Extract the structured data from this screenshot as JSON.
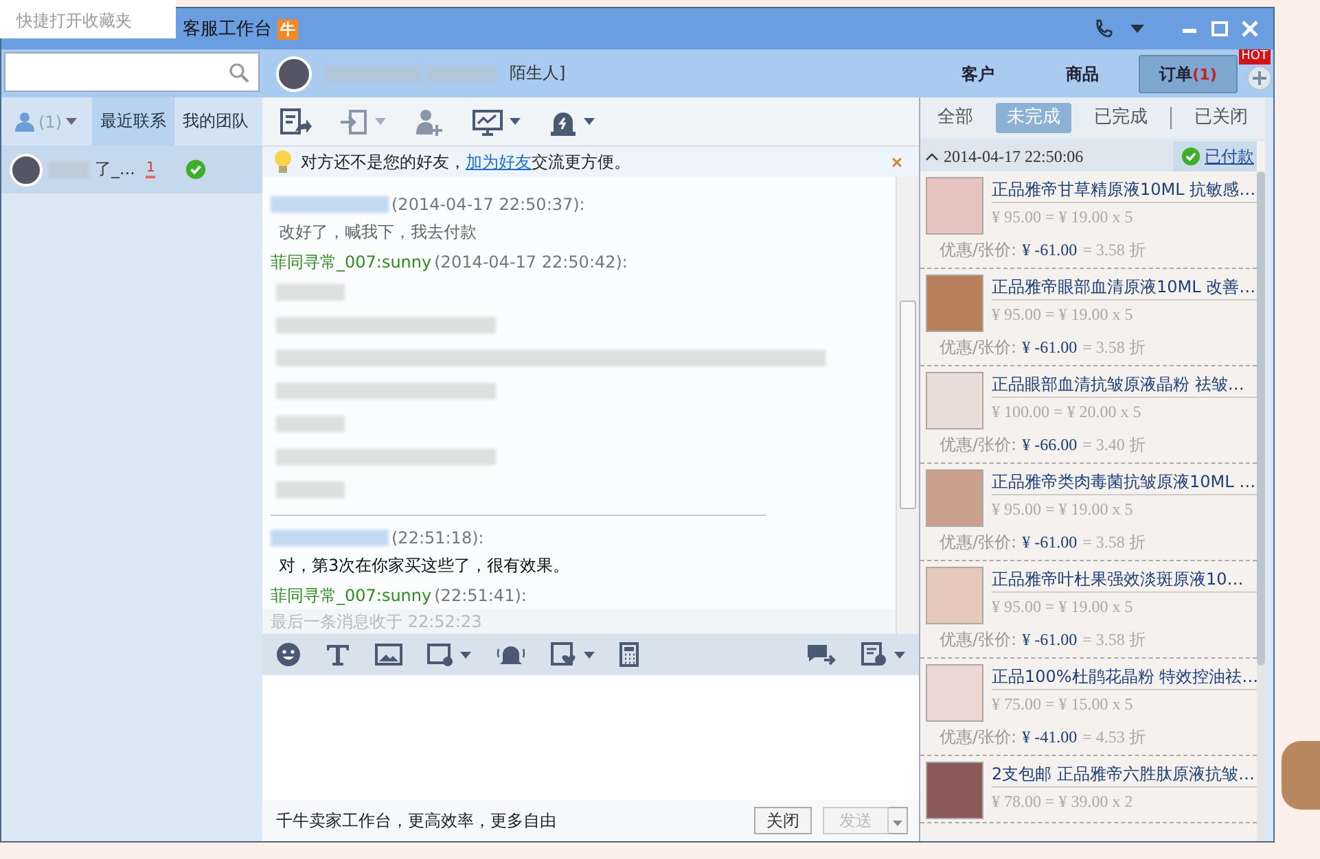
{
  "popup": {
    "hint": "快捷打开收藏夹"
  },
  "window": {
    "title": "客服工作台",
    "logo_char": "牛"
  },
  "left": {
    "tabs": [
      {
        "kind": "person",
        "label": "(1)",
        "selected": false
      },
      {
        "kind": "text",
        "label": "最近联系",
        "selected": true
      },
      {
        "kind": "text",
        "label": "我的团队",
        "selected": false
      }
    ],
    "contacts": [
      {
        "name": "了_...",
        "badge": "1",
        "online": true,
        "selected": true
      }
    ]
  },
  "chat": {
    "header": {
      "name": "陌生人]"
    },
    "notice": {
      "before": "对方还不是您的好友，",
      "link": "加为好友",
      "after": "交流更方便。",
      "close": "×"
    },
    "messages": [
      {
        "kind": "other",
        "sender_hidden": true,
        "time": "(2014-04-17 22:50:37):",
        "text": "改好了，喊我下，我去付款"
      },
      {
        "kind": "self",
        "sender_hidden": false,
        "sender": "菲同寻常_007:sunny",
        "time": "(2014-04-17 22:50:42):",
        "body_hidden": true
      },
      {
        "kind": "other",
        "sender_hidden": true,
        "time": "(22:51:18):",
        "text": "对，第3次在你家买这些了，很有效果。"
      },
      {
        "kind": "self",
        "sender_hidden": false,
        "sender": "菲同寻常_007:sunny",
        "time": "(22:51:41):"
      }
    ],
    "last_received": "最后一条消息收于 22:52:23",
    "footer": "千牛卖家工作台，更高效率，更多自由",
    "buttons": [
      {
        "label": "关闭",
        "disabled": false
      },
      {
        "label": "发送",
        "disabled": true
      }
    ]
  },
  "right": {
    "tabs": [
      {
        "label": "客户",
        "selected": false
      },
      {
        "label": "商品",
        "selected": false
      },
      {
        "label": "订单",
        "count": "(1)",
        "selected": true
      }
    ],
    "hot": "HOT",
    "filters": [
      {
        "label": "全部",
        "selected": false
      },
      {
        "label": "未完成",
        "selected": true
      },
      {
        "label": "已完成",
        "selected": false
      },
      {
        "label": "已关闭",
        "selected": false
      }
    ],
    "order": {
      "time": "2014-04-17 22:50:06",
      "status": "已付款",
      "items": [
        {
          "title": "正品雅帝甘草精原液10ML 抗敏感…",
          "price": "¥ 95.00 = ¥ 19.00 x 5",
          "discount_label": "优惠/张价:",
          "discount_value": "¥ -61.00",
          "discount_rate": "= 3.58 折",
          "color": "#e8c4c0"
        },
        {
          "title": "正品雅帝眼部血清原液10ML 改善…",
          "price": "¥ 95.00 = ¥ 19.00 x 5",
          "discount_label": "优惠/张价:",
          "discount_value": "¥ -61.00",
          "discount_rate": "= 3.58 折",
          "color": "#b7805a"
        },
        {
          "title": "正品眼部血清抗皱原液晶粉 祛皱…",
          "price": "¥ 100.00 = ¥ 20.00 x 5",
          "discount_label": "优惠/张价:",
          "discount_value": "¥ -66.00",
          "discount_rate": "= 3.40 折",
          "color": "#eadcd6"
        },
        {
          "title": "正品雅帝类肉毒菌抗皱原液10ML …",
          "price": "¥ 95.00 = ¥ 19.00 x 5",
          "discount_label": "优惠/张价:",
          "discount_value": "¥ -61.00",
          "discount_rate": "= 3.58 折",
          "color": "#c9a08c"
        },
        {
          "title": "正品雅帝叶杜果强效淡斑原液10…",
          "price": "¥ 95.00 = ¥ 19.00 x 5",
          "discount_label": "优惠/张价:",
          "discount_value": "¥ -61.00",
          "discount_rate": "= 3.58 折",
          "color": "#e6c8bd"
        },
        {
          "title": "正品100%杜鹃花晶粉 特效控油祛…",
          "price": "¥ 75.00 = ¥ 15.00 x 5",
          "discount_label": "优惠/张价:",
          "discount_value": "¥ -41.00",
          "discount_rate": "= 4.53 折",
          "color": "#ecd8d2"
        },
        {
          "title": "2支包邮 正品雅帝六胜肽原液抗皱…",
          "price": "¥ 78.00 = ¥ 39.00 x 2",
          "color": "#8a5a58"
        }
      ]
    }
  }
}
